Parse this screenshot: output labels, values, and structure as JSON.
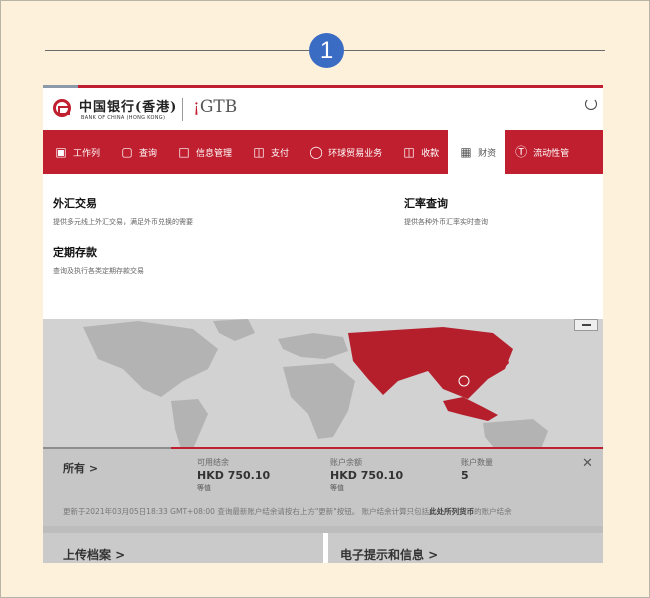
{
  "step": {
    "number": "1"
  },
  "header": {
    "bank_name_cn": "中国银行(香港)",
    "bank_name_en": "BANK OF CHINA (HONG KONG)",
    "product_logo": "GTB"
  },
  "nav": {
    "items": [
      {
        "label": "工作列",
        "icon": "briefcase-icon"
      },
      {
        "label": "查询",
        "icon": "search-doc-icon"
      },
      {
        "label": "信息管理",
        "icon": "folder-icon"
      },
      {
        "label": "支付",
        "icon": "payment-icon"
      },
      {
        "label": "环球贸易业务",
        "icon": "globe-icon"
      },
      {
        "label": "收款",
        "icon": "receive-icon"
      },
      {
        "label": "财资",
        "icon": "treasury-icon",
        "active": true
      },
      {
        "label": "流动性管",
        "icon": "dollar-icon"
      }
    ]
  },
  "dropdown": {
    "fx_title": "外汇交易",
    "fx_desc": "提供多元线上外汇交易，满足外币兑换的需要",
    "rate_title": "汇率查询",
    "rate_desc": "提供各种外币汇率实时查询",
    "deposit_title": "定期存款",
    "deposit_desc": "查询及执行各类定期存款交易"
  },
  "summary": {
    "all_label": "所有 >",
    "available_label": "可用结余",
    "available_value": "HKD 750.10",
    "available_sub": "等值",
    "balance_label": "账户余额",
    "balance_value": "HKD 750.10",
    "balance_sub": "等值",
    "count_label": "账户数量",
    "count_value": "5"
  },
  "note": {
    "text_a": "更新于2021年03月05日18:33 GMT+08:00   查询最新账户结余请按右上方\"更新\"按钮。   账户结余计算只包括",
    "text_b": "此处所列货币",
    "text_c": "的账户结余"
  },
  "panels": {
    "upload_title": "上传档案 >",
    "alerts_title": "电子提示和信息 >"
  },
  "colors": {
    "brand_red": "#c01f2f",
    "step_blue": "#3b6cc4",
    "background": "#fdf1dc"
  }
}
